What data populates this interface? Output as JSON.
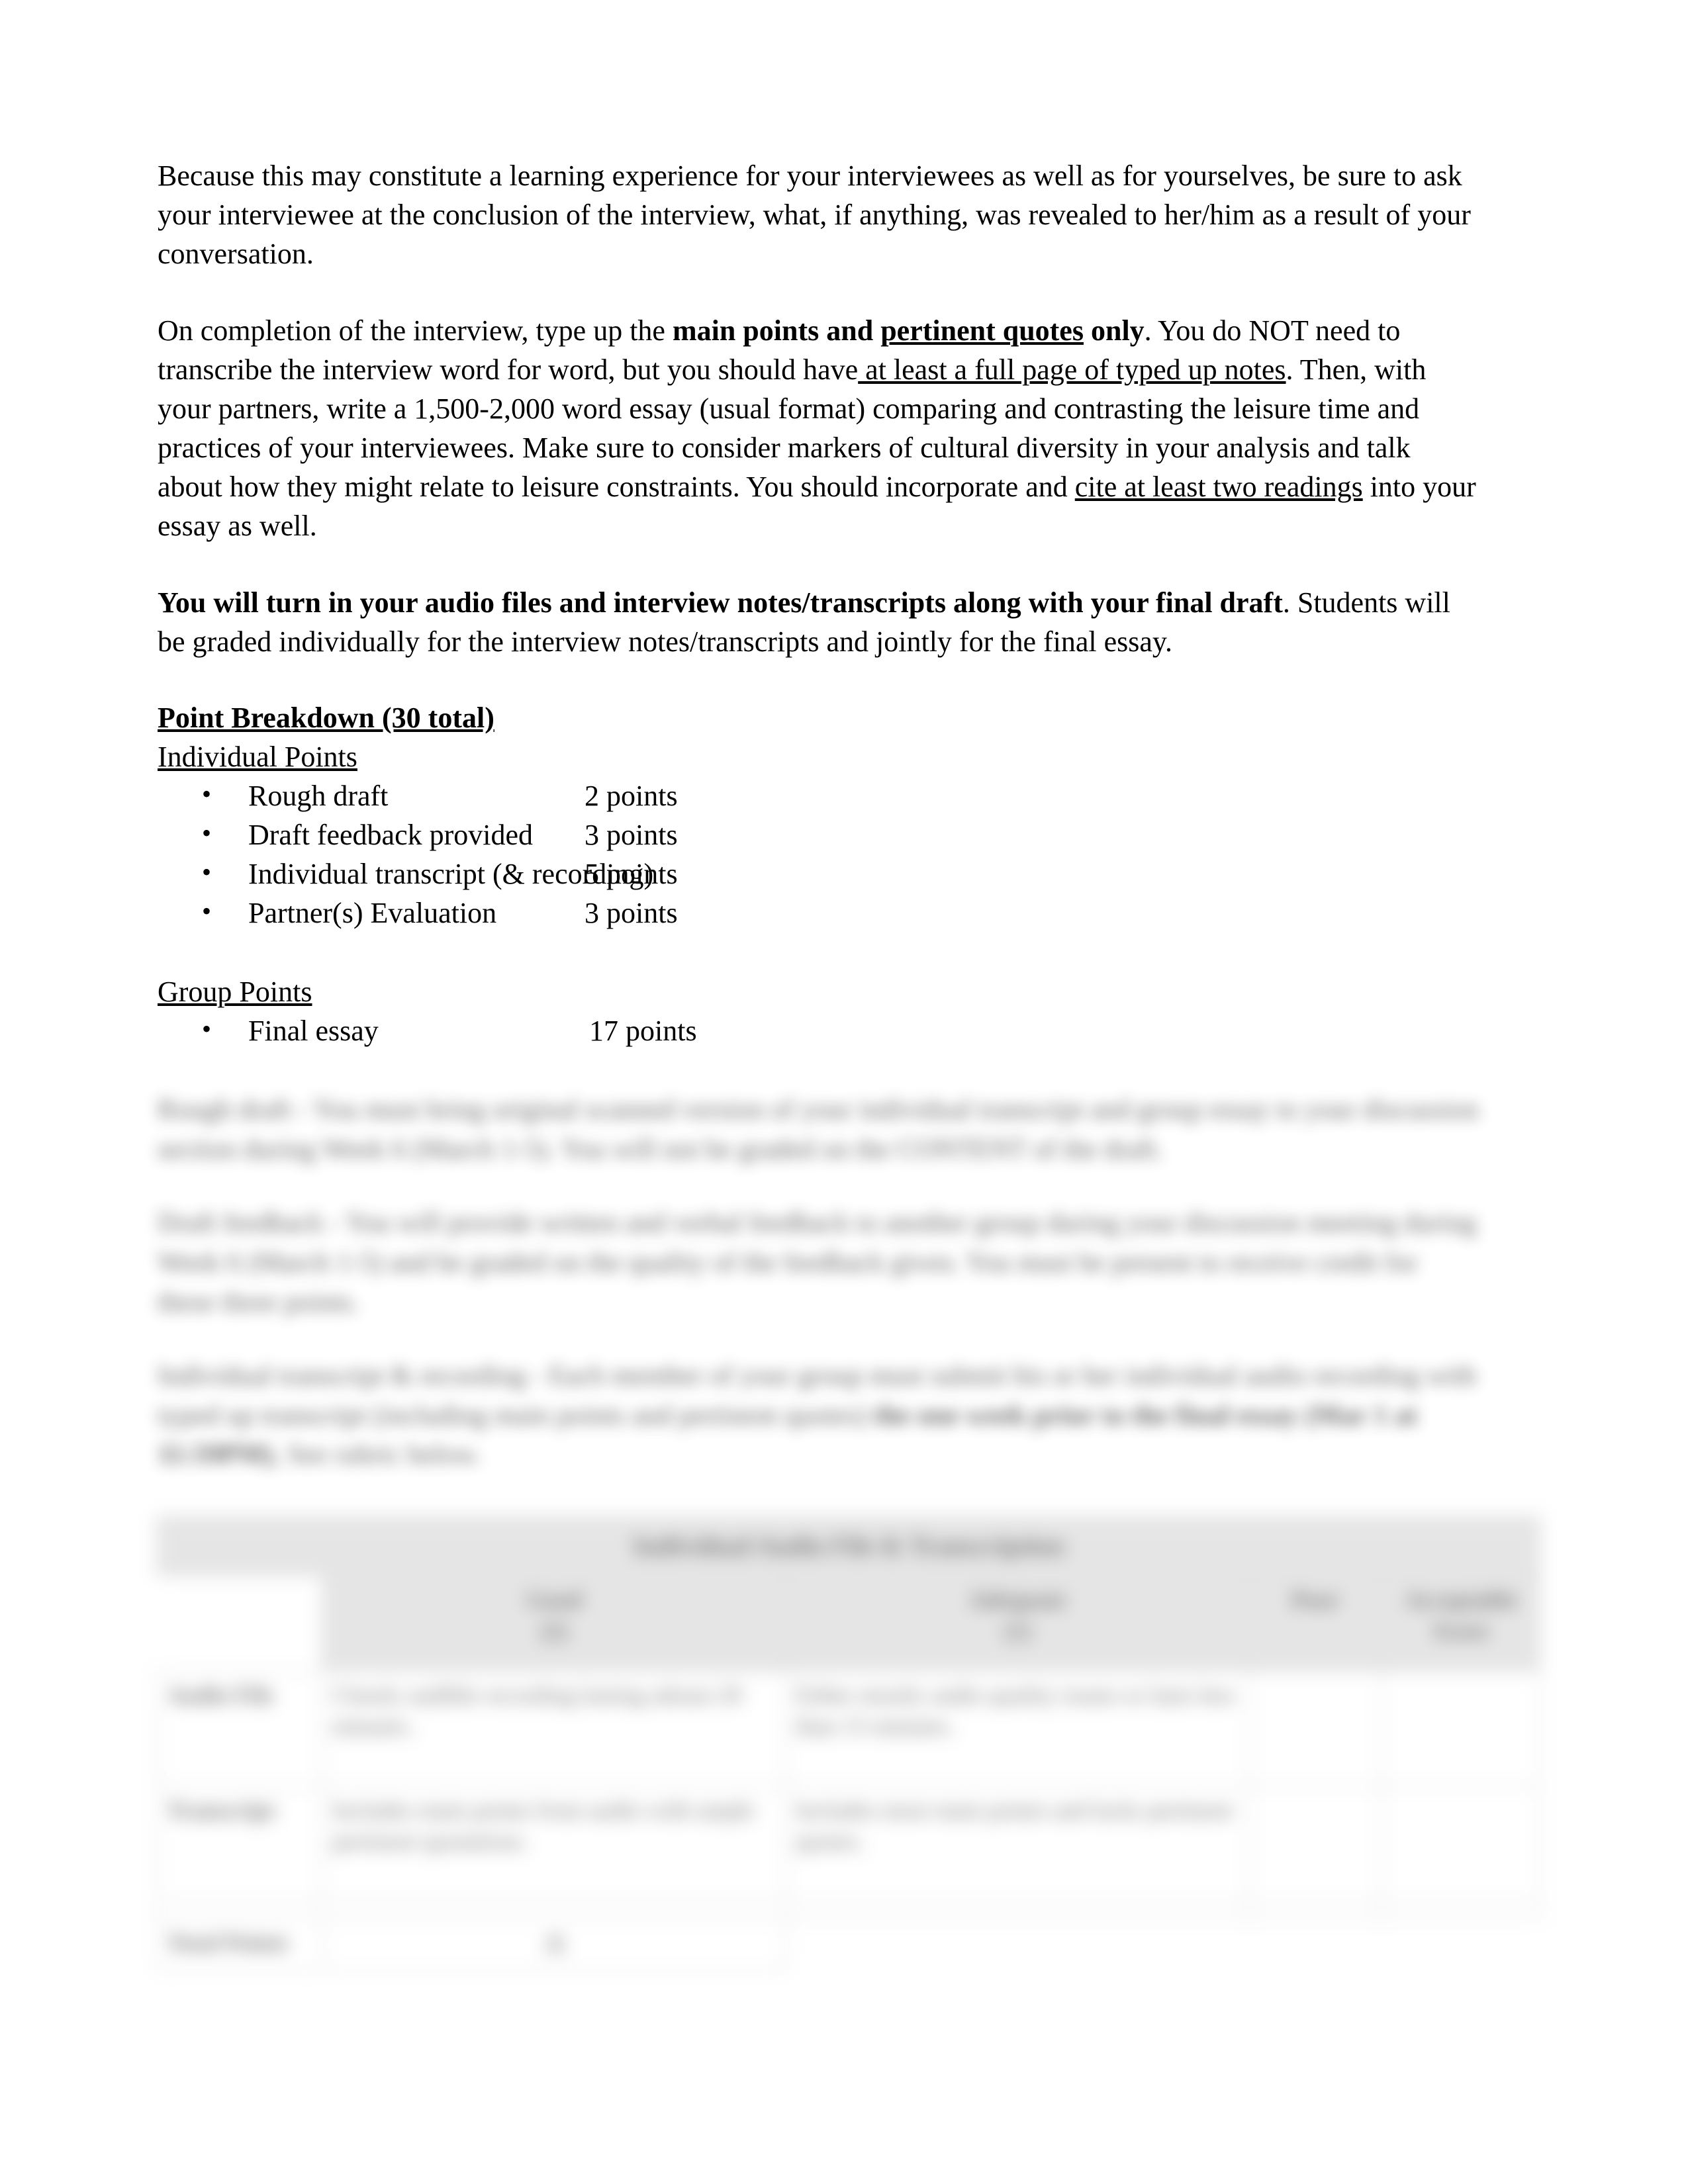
{
  "document": {
    "paragraphs": {
      "p1": "Because this may constitute a learning experience for your interviewees as well as for yourselves, be sure to ask your interviewee at the conclusion of the interview, what, if anything, was revealed to her/him as a result of your conversation.",
      "p2_a": "On completion of the interview, type up the ",
      "p2_b_bold": "main points and ",
      "p2_c_bold_underline": "pertinent quotes",
      "p2_d_bold": " only",
      "p2_e": ". You do NOT need to transcribe the interview word for word, but you should have",
      "p2_f_underline": " at least a full page of typed up notes",
      "p2_g": ". Then, with your partners, write a 1,500-2,000 word essay (usual format) comparing and contrasting the leisure time and practices of your interviewees. Make sure to consider markers of cultural diversity in your analysis and talk about how they might relate to leisure constraints. You should incorporate and ",
      "p2_h_underline": "cite at least two readings",
      "p2_i": " into your essay as well.",
      "p3_bold": "You will turn in your audio files and interview notes/transcripts along with your final draft",
      "p3_rest": ". Students will be graded individually for the interview notes/transcripts and jointly for the final essay."
    },
    "point_breakdown": {
      "heading": "Point Breakdown (30 total)",
      "individual_label": "Individual Points",
      "individual_items": [
        {
          "bullet": "•",
          "label": "Rough draft",
          "points": "2 points"
        },
        {
          "bullet": "•",
          "label": "Draft feedback provided",
          "points": "3 points"
        },
        {
          "bullet": "•",
          "label": "Individual transcript (& recording)",
          "points": "5 points"
        },
        {
          "bullet": "•",
          "label": "Partner(s) Evaluation",
          "points": "3 points"
        }
      ],
      "group_label": "Group Points",
      "group_items": [
        {
          "bullet": "•",
          "label": "Final essay",
          "points": "17 points"
        }
      ]
    },
    "redacted_section": {
      "note": "lower portion of page is blurred/illegible",
      "para1": "Rough draft - You must bring original scanned version of your individual transcript and group essay to your discussion section during Week 6 (March 1-5). You will not be graded on the CONTENT of the draft.",
      "para2": "Draft feedback - You will provide written and verbal feedback to another group during your discussion meeting during Week 6 (March 1-5) and be graded on the quality of the feedback given. You must be present to receive credit for these three points.",
      "para3_a": "Individual transcript & recording - Each member of your group must submit his or her individual audio recording with typed up transcript (including main points and pertinent quotes) ",
      "para3_bold": "the one week prior to the final essay (Mar 1 at 11:59PM)",
      "para3_c": ", See rubric below."
    },
    "rubric_table": {
      "title": "Individual Audio File & Transcription",
      "columns": [
        "",
        "Good\n(2)",
        "Adequate\n(1)",
        "Poor\n(0)",
        "Acceptable\nScore"
      ],
      "col_good_label": "Good",
      "col_good_score": "(2)",
      "col_adequate_label": "Adequate",
      "col_adequate_score": "(1)",
      "col_poor_label": "Poor",
      "col_acceptable_label": "Acceptable",
      "col_acceptable_sub": "Score",
      "rows": [
        {
          "label": "Audio File",
          "good": "Clearly audible recording lasting atleast 20 minutes.",
          "adequate": "Either mostly audio quality issues or lasts less than 15 minutes.",
          "poor": "",
          "score": ""
        },
        {
          "label": "Transcript",
          "good": "Includes main points from audio with ample pertinent quotations.",
          "adequate": "Includes most main points and lacks pertinent quotes.",
          "poor": "",
          "score": ""
        },
        {
          "label": "",
          "good": "",
          "adequate": "",
          "poor": "",
          "score": ""
        },
        {
          "label": "Total Points",
          "good": "/5",
          "adequate": "",
          "poor": "",
          "score": ""
        }
      ]
    }
  }
}
